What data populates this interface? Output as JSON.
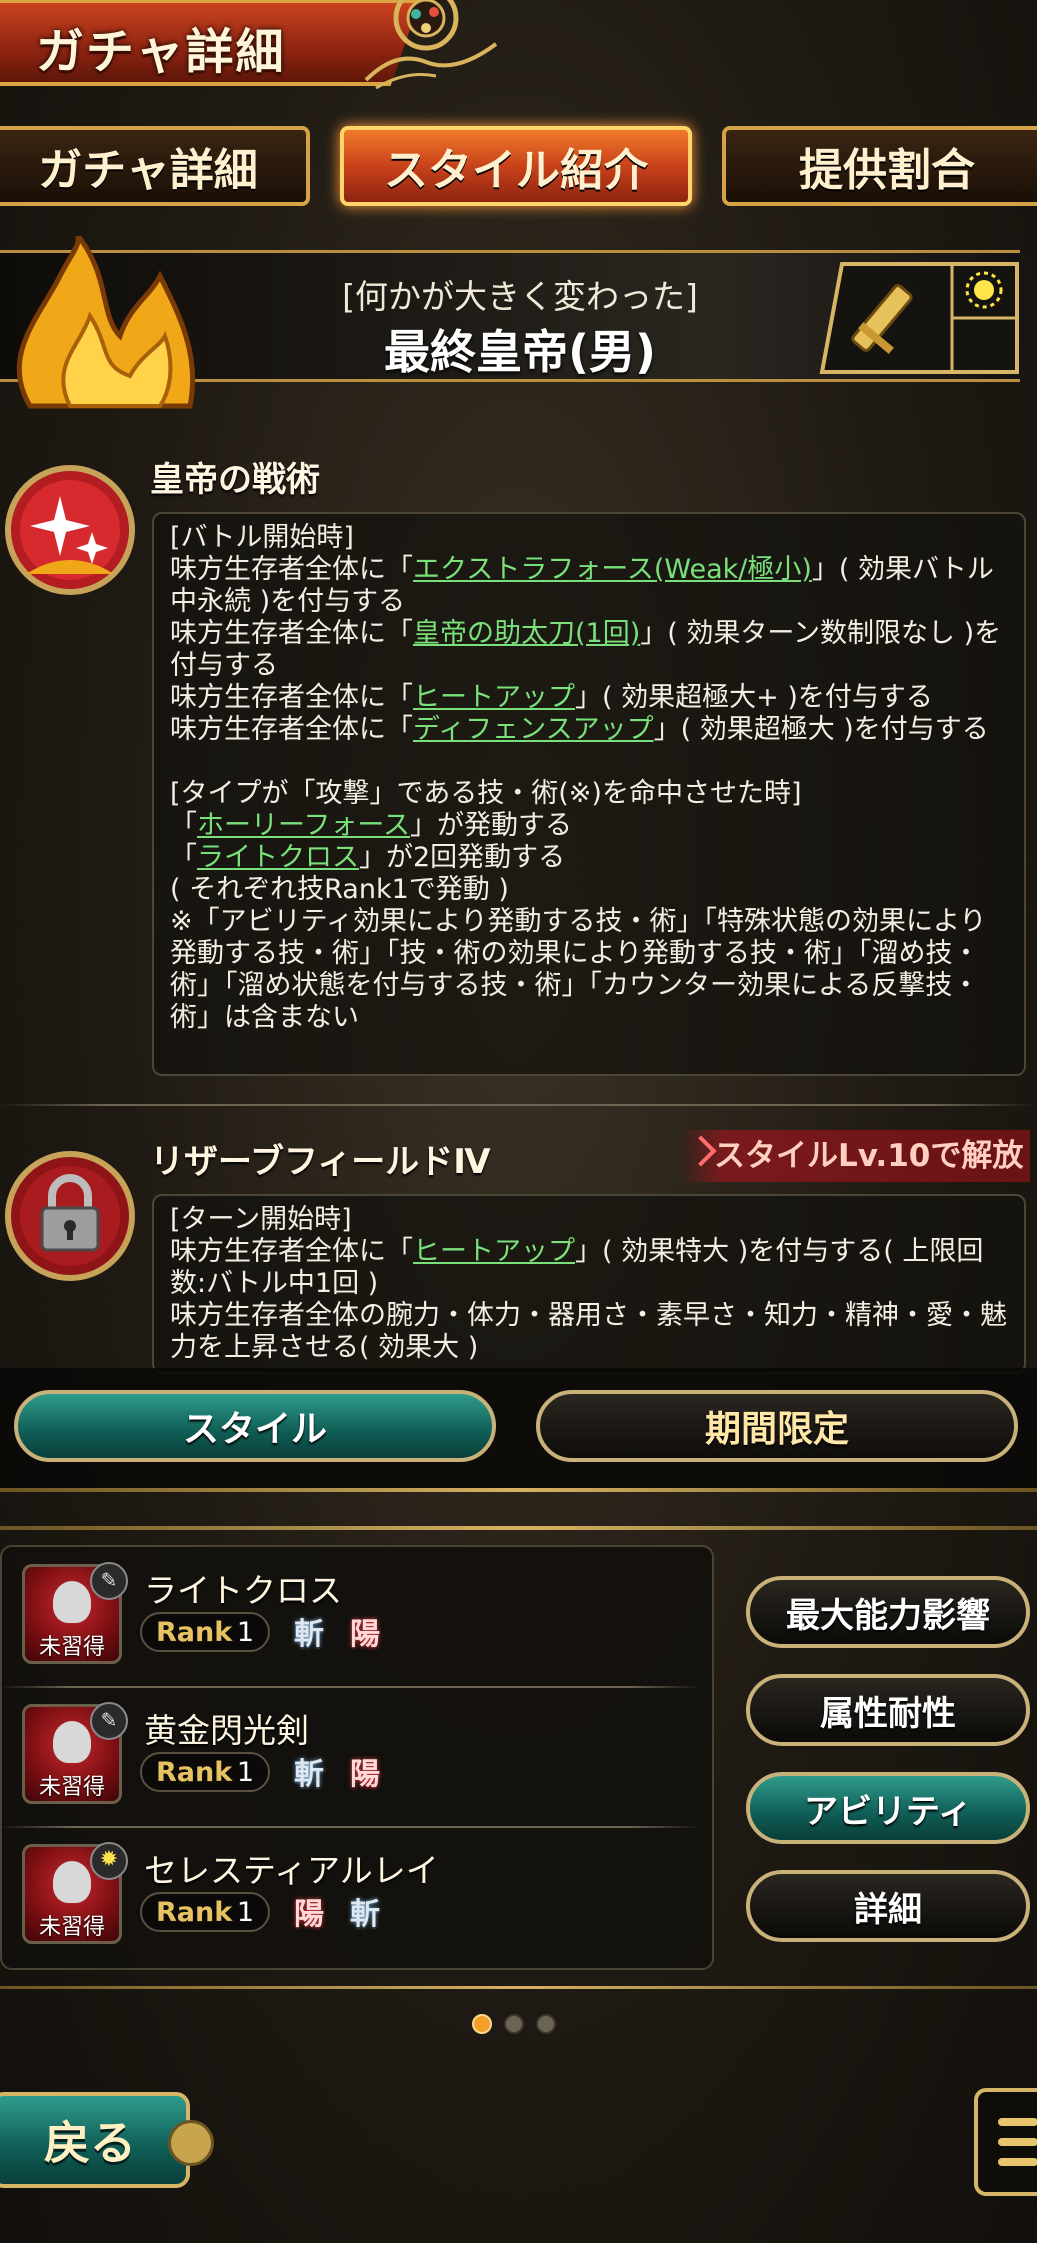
{
  "header": {
    "title": "ガチャ詳細"
  },
  "tabs": [
    {
      "label": "ガチャ詳細",
      "active": false
    },
    {
      "label": "スタイル紹介",
      "active": true
    },
    {
      "label": "提供割合",
      "active": false
    }
  ],
  "style": {
    "subtitle": "[何かが大きく変わった]",
    "name": "最終皇帝(男)",
    "weapon_icon": "sword-icon",
    "element_icon": "sun-icon"
  },
  "abilities": [
    {
      "title": "皇帝の戦術",
      "icon": "sparkle-icon",
      "lines": [
        "[バトル開始時]",
        "味方生存者全体に「エクストラフォース(Weak/極小)」( 効果バトル中永続 )を付与する",
        "味方生存者全体に「皇帝の助太刀(1回)」( 効果ターン数制限なし )を付与する",
        "味方生存者全体に「ヒートアップ」( 効果超極大+ )を付与する",
        "味方生存者全体に「ディフェンスアップ」( 効果超極大 )を付与する",
        "",
        "[タイプが「攻撃」である技・術(※)を命中させた時]",
        "「ホーリーフォース」が発動する",
        "「ライトクロス」が2回発動する",
        "( それぞれ技Rank1で発動 )",
        "※「アビリティ効果により発動する技・術」「特殊状態の効果により発動する技・術」「技・術の効果により発動する技・術」「溜め技・術」「溜め状態を付与する技・術」「カウンター効果による反撃技・術」は含まない"
      ]
    },
    {
      "title": "リザーブフィールドⅣ",
      "icon": "lock-icon",
      "unlock": "スタイルLv.10で解放",
      "lines": [
        "[ターン開始時]",
        "味方生存者全体に「ヒートアップ」( 効果特大 )を付与する( 上限回数:バトル中1回 )",
        "味方生存者全体の腕力・体力・器用さ・素早さ・知力・精神・愛・魅力を上昇させる( 効果大 )"
      ]
    }
  ],
  "toggles": {
    "style": "スタイル",
    "limited": "期間限定"
  },
  "skills": [
    {
      "name": "ライトクロス",
      "status": "未習得",
      "rank_label": "Rank",
      "rank": "1",
      "attrs": [
        "斬",
        "陽"
      ],
      "badge": "pen-icon"
    },
    {
      "name": "黄金閃光剣",
      "status": "未習得",
      "rank_label": "Rank",
      "rank": "1",
      "attrs": [
        "斬",
        "陽"
      ],
      "badge": "pen-icon"
    },
    {
      "name": "セレスティアルレイ",
      "status": "未習得",
      "rank_label": "Rank",
      "rank": "1",
      "attrs": [
        "陽",
        "斬"
      ],
      "badge": "sun-icon"
    }
  ],
  "side_buttons": [
    {
      "label": "最大能力影響",
      "active": false
    },
    {
      "label": "属性耐性",
      "active": false
    },
    {
      "label": "アビリティ",
      "active": true
    },
    {
      "label": "詳細",
      "active": false
    }
  ],
  "pagination": {
    "pages": 3,
    "current": 1
  },
  "footer": {
    "back_label": "戻る",
    "menu_icon": "hamburger-menu-icon"
  },
  "colors": {
    "accent_teal": "#0f5d55",
    "gold": "#d6a248",
    "link_green": "#79e07a",
    "tab_active": "#c8421a"
  }
}
